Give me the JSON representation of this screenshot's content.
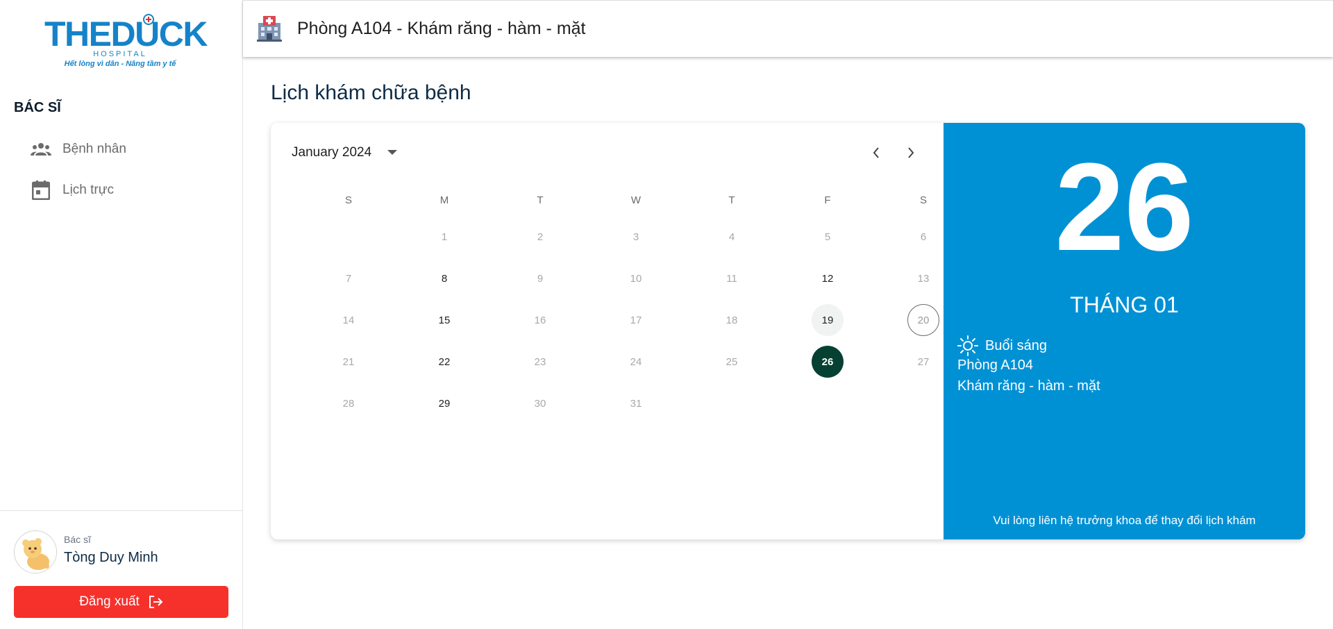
{
  "brand": {
    "name": "THEDUCK",
    "sub": "HOSPITAL",
    "tagline": "Hết lòng vì dân - Nâng tầm y tế",
    "primary_color": "#1583c9"
  },
  "sidebar": {
    "role_title": "BÁC SĨ",
    "items": [
      {
        "label": "Bệnh nhân",
        "icon": "group-icon"
      },
      {
        "label": "Lịch trực",
        "icon": "calendar-icon"
      }
    ],
    "user": {
      "role": "Bác sĩ",
      "name": "Tòng Duy Minh"
    },
    "logout_label": "Đăng xuất",
    "logout_color": "#f6302b"
  },
  "topbar": {
    "room_title": "Phòng A104 - Khám răng - hàm - mặt",
    "icon": "hospital-building-icon"
  },
  "main": {
    "page_title": "Lịch khám chữa bệnh"
  },
  "calendar": {
    "month_label": "January 2024",
    "weekdays": [
      "S",
      "M",
      "T",
      "W",
      "T",
      "F",
      "S"
    ],
    "weeks": [
      [
        "",
        "1",
        "2",
        "3",
        "4",
        "5",
        "6"
      ],
      [
        "7",
        "8",
        "9",
        "10",
        "11",
        "12",
        "13"
      ],
      [
        "14",
        "15",
        "16",
        "17",
        "18",
        "19",
        "20"
      ],
      [
        "21",
        "22",
        "23",
        "24",
        "25",
        "26",
        "27"
      ],
      [
        "28",
        "29",
        "30",
        "31",
        "",
        "",
        ""
      ]
    ],
    "scheduled_days": [
      "8",
      "12",
      "15",
      "19",
      "22",
      "26",
      "29"
    ],
    "today": "20",
    "highlighted": "19",
    "selected": "26",
    "selected_color": "#064032"
  },
  "detail": {
    "day": "26",
    "month": "THÁNG 01",
    "shift": "Buổi sáng",
    "room": "Phòng A104",
    "specialty": "Khám răng - hàm - mặt",
    "notice": "Vui lòng liên hệ trưởng khoa để thay đổi lịch khám",
    "panel_color": "#0091d5"
  }
}
